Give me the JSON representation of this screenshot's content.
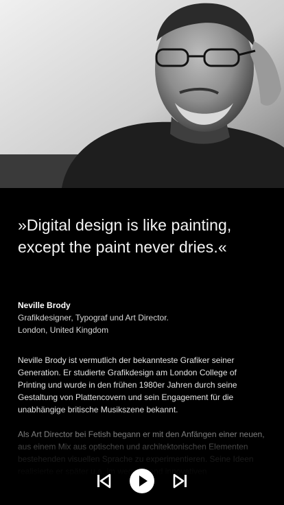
{
  "quote": "»Digital design is like painting, except the paint never dries.«",
  "person": {
    "name": "Neville Brody",
    "role": "Grafikdesigner, Typograf und Art Director.",
    "location": "London, United Kingdom"
  },
  "bio": [
    "Neville Brody ist vermutlich der bekannteste Grafiker seiner Generation. Er studierte Grafikdesign am London College of Printing und wurde in den frühen 1980er Jahren durch seine Gestaltung von Plattencovern und sein Engagement für die unabhängige britische Musikszene bekannt.",
    "Als Art Director bei Fetish begann er mit den Anfängen einer neuen, aus einem Mix aus optischen und architektonischen Elementen bestehenden visuellen Sprache zu experimentieren. Seine Ideen realisierte er später u.a. im wegweisend innovativen"
  ],
  "player": {
    "previous_icon": "skip-previous-icon",
    "play_icon": "play-icon",
    "next_icon": "skip-next-icon"
  },
  "colors": {
    "background": "#000000",
    "text": "#ffffff"
  }
}
